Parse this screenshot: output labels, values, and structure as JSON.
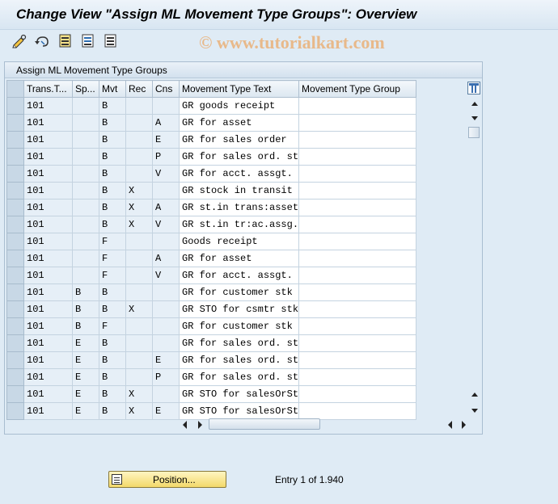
{
  "title": "Change View \"Assign ML Movement Type Groups\": Overview",
  "watermark": "© www.tutorialkart.com",
  "toolbar": {
    "icons": [
      "display-change-icon",
      "undo-icon",
      "select-all-icon",
      "select-block-icon",
      "deselect-all-icon"
    ]
  },
  "panel": {
    "title": "Assign ML Movement Type Groups",
    "columns": [
      "Trans.T...",
      "Sp...",
      "Mvt",
      "Rec",
      "Cns",
      "Movement Type Text",
      "Movement Type Group"
    ],
    "rows": [
      [
        "101",
        "",
        "B",
        "",
        "",
        "GR goods receipt",
        ""
      ],
      [
        "101",
        "",
        "B",
        "",
        "A",
        "GR for asset",
        ""
      ],
      [
        "101",
        "",
        "B",
        "",
        "E",
        "GR for sales order",
        ""
      ],
      [
        "101",
        "",
        "B",
        "",
        "P",
        "GR for sales ord. st",
        ""
      ],
      [
        "101",
        "",
        "B",
        "",
        "V",
        "GR for acct. assgt.",
        ""
      ],
      [
        "101",
        "",
        "B",
        "X",
        "",
        "GR stock in transit",
        ""
      ],
      [
        "101",
        "",
        "B",
        "X",
        "A",
        "GR st.in trans:asset",
        ""
      ],
      [
        "101",
        "",
        "B",
        "X",
        "V",
        "GR st.in tr:ac.assg.",
        ""
      ],
      [
        "101",
        "",
        "F",
        "",
        "",
        "Goods receipt",
        ""
      ],
      [
        "101",
        "",
        "F",
        "",
        "A",
        "GR for asset",
        ""
      ],
      [
        "101",
        "",
        "F",
        "",
        "V",
        "GR for acct. assgt.",
        ""
      ],
      [
        "101",
        "B",
        "B",
        "",
        "",
        "GR for customer stk",
        ""
      ],
      [
        "101",
        "B",
        "B",
        "X",
        "",
        "GR STO for csmtr stk",
        ""
      ],
      [
        "101",
        "B",
        "F",
        "",
        "",
        "GR for customer stk",
        ""
      ],
      [
        "101",
        "E",
        "B",
        "",
        "",
        "GR for sales ord. st",
        ""
      ],
      [
        "101",
        "E",
        "B",
        "",
        "E",
        "GR for sales ord. st",
        ""
      ],
      [
        "101",
        "E",
        "B",
        "",
        "P",
        "GR for sales ord. st",
        ""
      ],
      [
        "101",
        "E",
        "B",
        "X",
        "",
        "GR STO for salesOrSt",
        ""
      ],
      [
        "101",
        "E",
        "B",
        "X",
        "E",
        "GR STO for salesOrSt",
        ""
      ]
    ]
  },
  "footer": {
    "position_button": "Position...",
    "entry_text": "Entry 1 of 1.940"
  },
  "colors": {
    "background": "#dfebf5",
    "button_yellow": "#f3d96a",
    "watermark": "#e8b98a"
  }
}
